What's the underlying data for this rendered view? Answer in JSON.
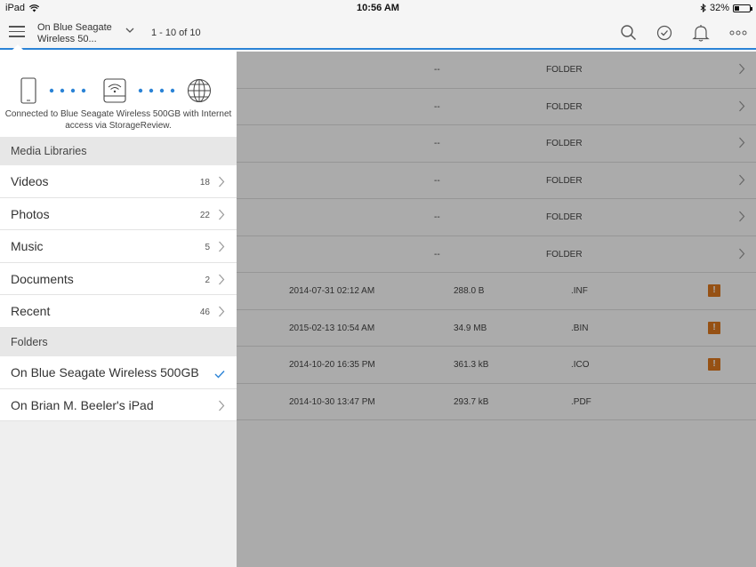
{
  "status": {
    "device": "iPad",
    "time": "10:56 AM",
    "battery": "32%",
    "battery_level": 0.32
  },
  "navbar": {
    "location_line1": "On Blue Seagate",
    "location_line2": "Wireless 50...",
    "range": "1 - 10 of 10",
    "icons": [
      "menu-icon",
      "search-icon",
      "select-icon",
      "bell-icon",
      "more-icon"
    ]
  },
  "files": [
    {
      "date": "",
      "size": "--",
      "type": "FOLDER",
      "warning": false,
      "chevron": true
    },
    {
      "date": "",
      "size": "--",
      "type": "FOLDER",
      "warning": false,
      "chevron": true
    },
    {
      "date": "",
      "size": "--",
      "type": "FOLDER",
      "warning": false,
      "chevron": true
    },
    {
      "date": "",
      "size": "--",
      "type": "FOLDER",
      "warning": false,
      "chevron": true
    },
    {
      "date": "",
      "size": "--",
      "type": "FOLDER",
      "warning": false,
      "chevron": true
    },
    {
      "date": "",
      "size": "--",
      "type": "FOLDER",
      "warning": false,
      "chevron": true
    },
    {
      "date": "2014-07-31 02:12 AM",
      "size": "288.0 B",
      "type": ".INF",
      "warning": true,
      "chevron": false
    },
    {
      "date": "2015-02-13 10:54 AM",
      "size": "34.9 MB",
      "type": ".BIN",
      "warning": true,
      "chevron": false
    },
    {
      "date": "2014-10-20 16:35 PM",
      "size": "361.3 kB",
      "type": ".ICO",
      "warning": true,
      "chevron": false
    },
    {
      "date": "2014-10-30 13:47 PM",
      "size": "293.7 kB",
      "type": ".PDF",
      "warning": false,
      "chevron": false
    }
  ],
  "menu": {
    "connection_text": "Connected to Blue Seagate Wireless 500GB with Internet access via StorageReview.",
    "media_header": "Media Libraries",
    "media": [
      {
        "label": "Videos",
        "count": "18"
      },
      {
        "label": "Photos",
        "count": "22"
      },
      {
        "label": "Music",
        "count": "5"
      },
      {
        "label": "Documents",
        "count": "2"
      },
      {
        "label": "Recent",
        "count": "46"
      }
    ],
    "folders_header": "Folders",
    "folders": [
      {
        "label": "On Blue Seagate Wireless 500GB",
        "selected": true
      },
      {
        "label": "On Brian M. Beeler's iPad",
        "selected": false
      }
    ]
  },
  "colors": {
    "accent": "#2b83d6",
    "warning": "#e07a1f"
  }
}
